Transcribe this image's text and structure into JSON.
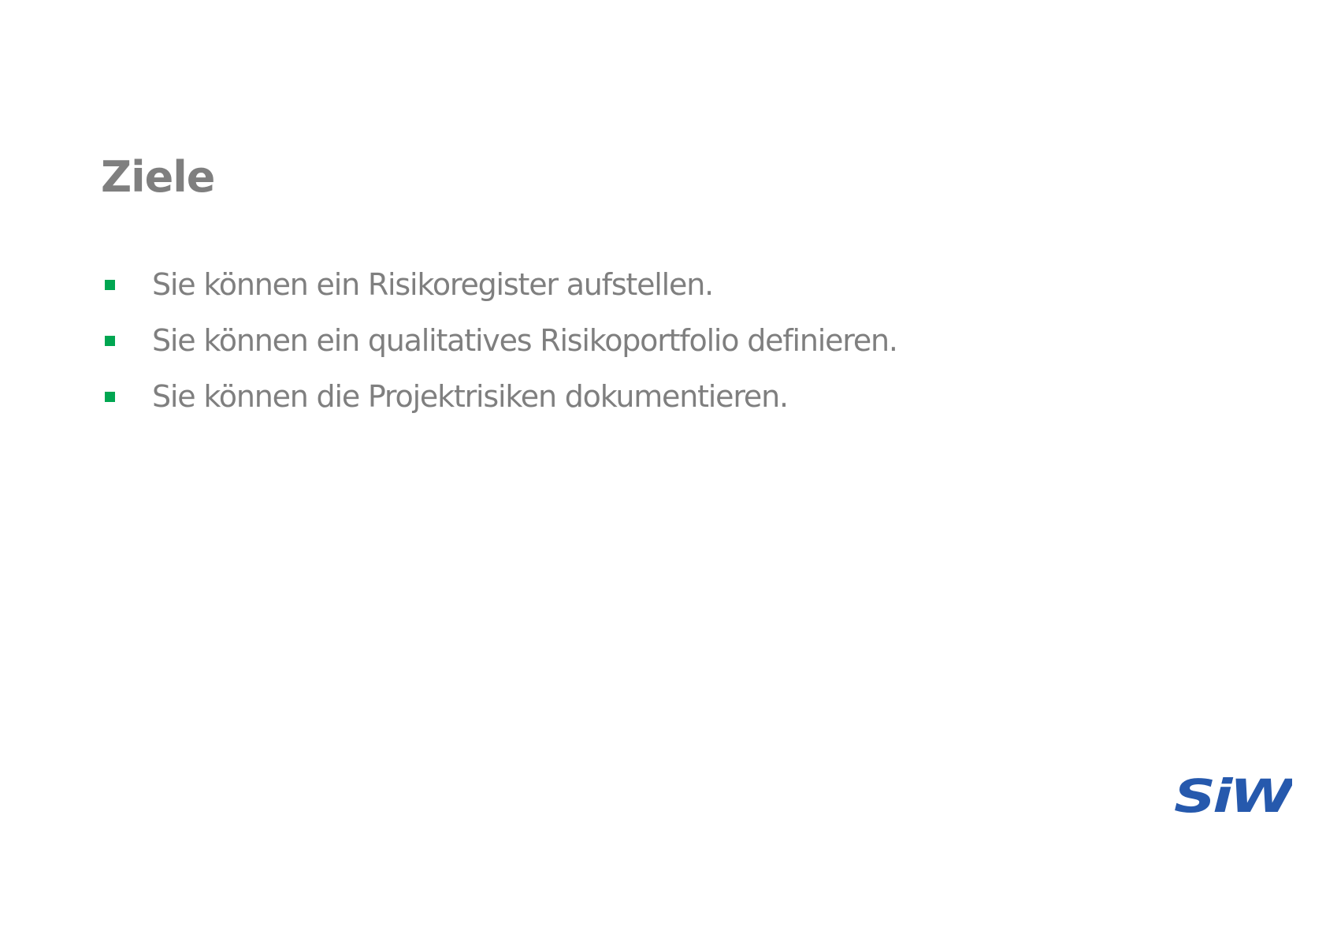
{
  "slide": {
    "title": "Ziele",
    "bullets": [
      "Sie können ein Risikoregister aufstellen.",
      "Sie können ein qualitatives Risikoportfolio definieren.",
      "Sie können die Projektrisiken dokumentieren."
    ],
    "logo_text": "SiW"
  },
  "colors": {
    "text": "#7f7f7f",
    "bullet": "#00a651",
    "logo": "#2659ad",
    "background": "#ffffff"
  },
  "icons": {
    "bullet": "green-square-bullet",
    "logo": "siw-logo"
  }
}
